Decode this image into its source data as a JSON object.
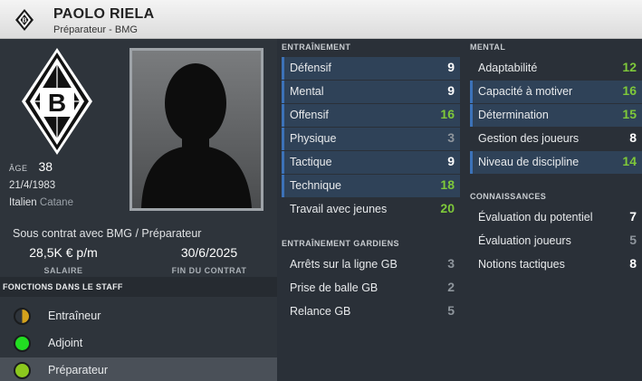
{
  "header": {
    "name": "PAOLO RIELA",
    "subtitle": "Préparateur - BMG"
  },
  "profile": {
    "age_label": "ÂGE",
    "age": "38",
    "birth_date": "21/4/1983",
    "nationality": "Italien",
    "city": "Catane",
    "contract_text": "Sous contrat avec BMG / Préparateur",
    "salary": "28,5K € p/m",
    "salary_label": "SALAIRE",
    "contract_end": "30/6/2025",
    "contract_end_label": "FIN DU CONTRAT"
  },
  "staff_functions": {
    "title": "FONCTIONS DANS LE STAFF",
    "items": [
      {
        "label": "Entraîneur",
        "color": "#d4a21c",
        "half": true
      },
      {
        "label": "Adjoint",
        "color": "#22dd22",
        "half": false
      },
      {
        "label": "Préparateur",
        "color": "#8cc81e",
        "half": false,
        "selected": true
      }
    ]
  },
  "training": {
    "title": "ENTRAÎNEMENT",
    "items": [
      {
        "label": "Défensif",
        "value": "9",
        "hl": true
      },
      {
        "label": "Mental",
        "value": "9",
        "hl": true
      },
      {
        "label": "Offensif",
        "value": "16",
        "hl": true
      },
      {
        "label": "Physique",
        "value": "3",
        "hl": true
      },
      {
        "label": "Tactique",
        "value": "9",
        "hl": true
      },
      {
        "label": "Technique",
        "value": "18",
        "hl": true
      },
      {
        "label": "Travail avec jeunes",
        "value": "20",
        "hl": false
      }
    ]
  },
  "gk_training": {
    "title": "ENTRAÎNEMENT GARDIENS",
    "items": [
      {
        "label": "Arrêts sur la ligne GB",
        "value": "3"
      },
      {
        "label": "Prise de balle GB",
        "value": "2"
      },
      {
        "label": "Relance GB",
        "value": "5"
      }
    ]
  },
  "mental": {
    "title": "MENTAL",
    "items": [
      {
        "label": "Adaptabilité",
        "value": "12",
        "hl": false
      },
      {
        "label": "Capacité à motiver",
        "value": "16",
        "hl": true
      },
      {
        "label": "Détermination",
        "value": "15",
        "hl": true
      },
      {
        "label": "Gestion des joueurs",
        "value": "8",
        "hl": false
      },
      {
        "label": "Niveau de discipline",
        "value": "14",
        "hl": true
      }
    ]
  },
  "knowledge": {
    "title": "CONNAISSANCES",
    "items": [
      {
        "label": "Évaluation du potentiel",
        "value": "7"
      },
      {
        "label": "Évaluation joueurs",
        "value": "5"
      },
      {
        "label": "Notions tactiques",
        "value": "8"
      }
    ]
  },
  "value_colors": {
    "high": "#7ec83a",
    "white": "#ffffff",
    "grey": "#8e959c"
  }
}
